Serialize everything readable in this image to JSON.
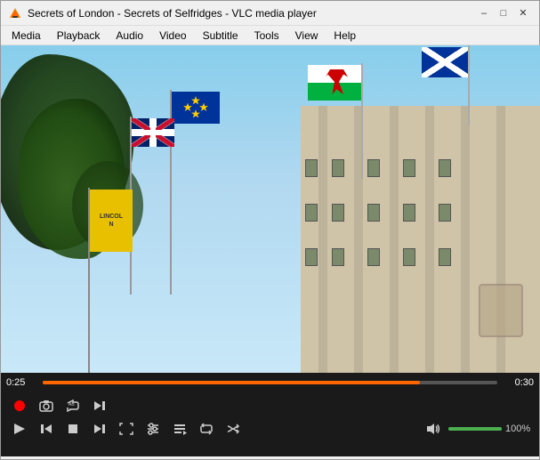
{
  "titlebar": {
    "title": "Secrets of London - Secrets of Selfridges - VLC media player",
    "minimize_label": "–",
    "maximize_label": "□",
    "close_label": "✕"
  },
  "menubar": {
    "items": [
      {
        "id": "media",
        "label": "Media"
      },
      {
        "id": "playback",
        "label": "Playback"
      },
      {
        "id": "audio",
        "label": "Audio"
      },
      {
        "id": "video",
        "label": "Video"
      },
      {
        "id": "subtitle",
        "label": "Subtitle"
      },
      {
        "id": "tools",
        "label": "Tools"
      },
      {
        "id": "view",
        "label": "View"
      },
      {
        "id": "help",
        "label": "Help"
      }
    ]
  },
  "progress": {
    "current_time": "0:25",
    "end_time": "0:30",
    "fill_percent": 83
  },
  "controls": {
    "row1": {
      "record_title": "Record",
      "snapshot_title": "Snapshot",
      "loop_title": "Loop",
      "next_frame_title": "Next Frame"
    },
    "row2": {
      "play_title": "Play",
      "prev_title": "Previous",
      "stop_title": "Stop",
      "next_title": "Next",
      "fullscreen_title": "Fullscreen",
      "ext_settings_title": "Extended Settings",
      "playlist_title": "Playlist",
      "repeat_title": "Repeat",
      "random_title": "Random"
    },
    "volume": {
      "level": "100%",
      "icon_title": "Volume"
    }
  }
}
